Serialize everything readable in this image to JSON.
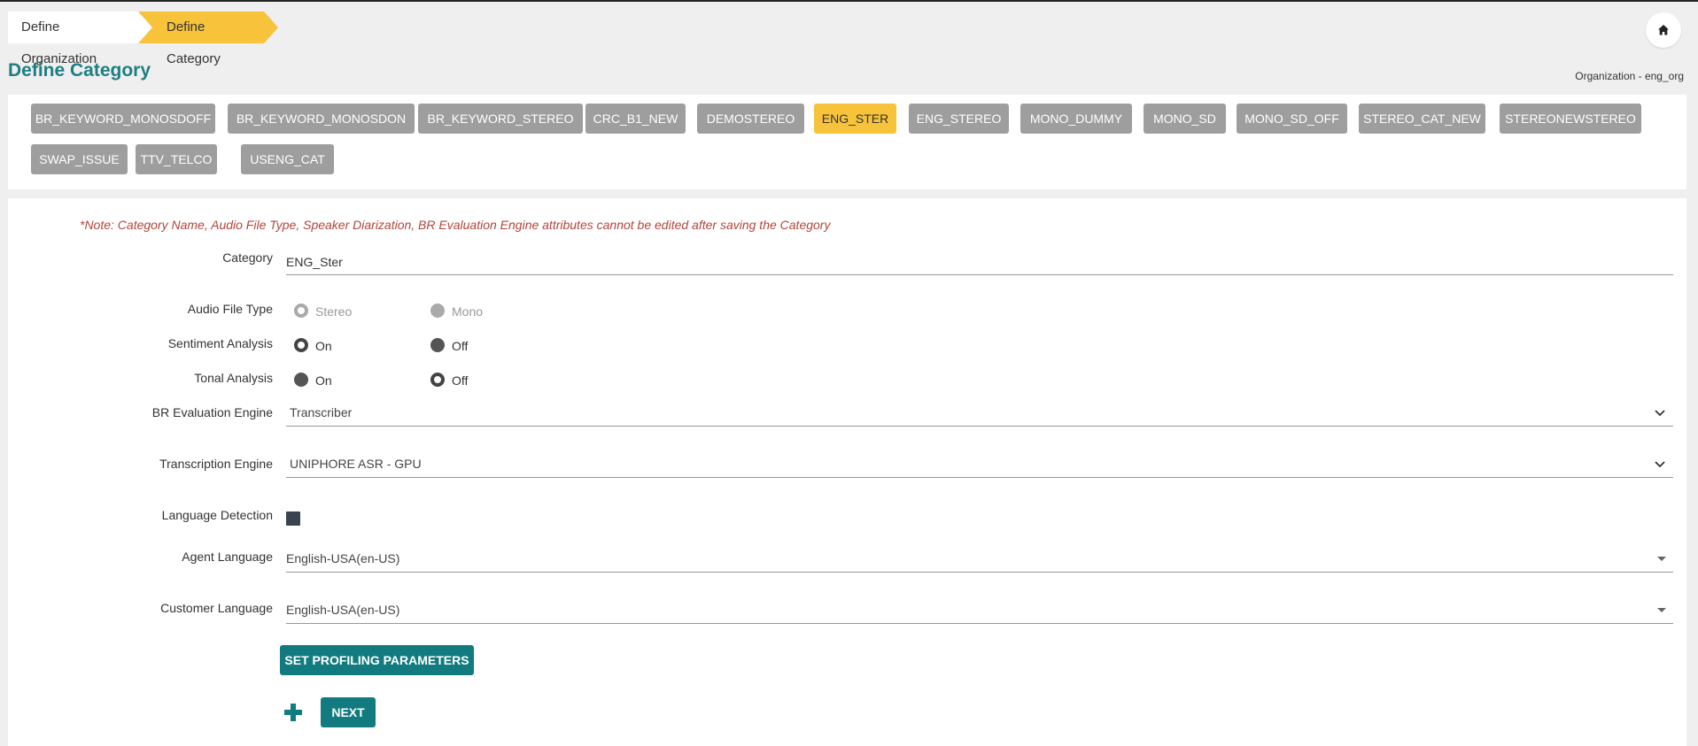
{
  "breadcrumb": {
    "items": [
      "Define Organization",
      "Define Category"
    ]
  },
  "header": {
    "title": "Define Category",
    "organization": "Organization - eng_org"
  },
  "categories": {
    "items": [
      "BR_KEYWORD_MONOSDOFF",
      "BR_KEYWORD_MONOSDON",
      "BR_KEYWORD_STEREO",
      "CRC_B1_NEW",
      "DEMOSTEREO",
      "ENG_STER",
      "ENG_STEREO",
      "MONO_DUMMY",
      "MONO_SD",
      "MONO_SD_OFF",
      "STEREO_CAT_NEW",
      "STEREONEWSTEREO",
      "SWAP_ISSUE",
      "TTV_TELCO",
      "USENG_CAT"
    ],
    "active": "ENG_STER"
  },
  "form": {
    "note": "*Note: Category Name, Audio File Type, Speaker Diarization, BR Evaluation Engine attributes cannot be edited after saving the Category",
    "category": {
      "label": "Category",
      "value": "ENG_Ster"
    },
    "audio_file_type": {
      "label": "Audio File Type",
      "options": [
        "Stereo",
        "Mono"
      ],
      "selected": "Stereo"
    },
    "sentiment_analysis": {
      "label": "Sentiment Analysis",
      "options": [
        "On",
        "Off"
      ],
      "selected": "On"
    },
    "tonal_analysis": {
      "label": "Tonal Analysis",
      "options": [
        "On",
        "Off"
      ],
      "selected": "Off"
    },
    "br_evaluation_engine": {
      "label": "BR Evaluation Engine",
      "value": "Transcriber"
    },
    "transcription_engine": {
      "label": "Transcription Engine",
      "value": "UNIPHORE ASR - GPU"
    },
    "language_detection": {
      "label": "Language Detection",
      "checked": true
    },
    "agent_language": {
      "label": "Agent Language",
      "value": "English-USA(en-US)"
    },
    "customer_language": {
      "label": "Customer Language",
      "value": "English-USA(en-US)"
    },
    "set_profiling_label": "SET PROFILING PARAMETERS",
    "next_label": "NEXT"
  },
  "colors": {
    "accent": "#117b7f",
    "highlight": "#f7c33b",
    "chip": "#9e9e9e",
    "note": "#b2453a"
  },
  "icons": {
    "home": "home-icon",
    "plus": "plus-icon",
    "chevron": "chevron-down-icon"
  }
}
